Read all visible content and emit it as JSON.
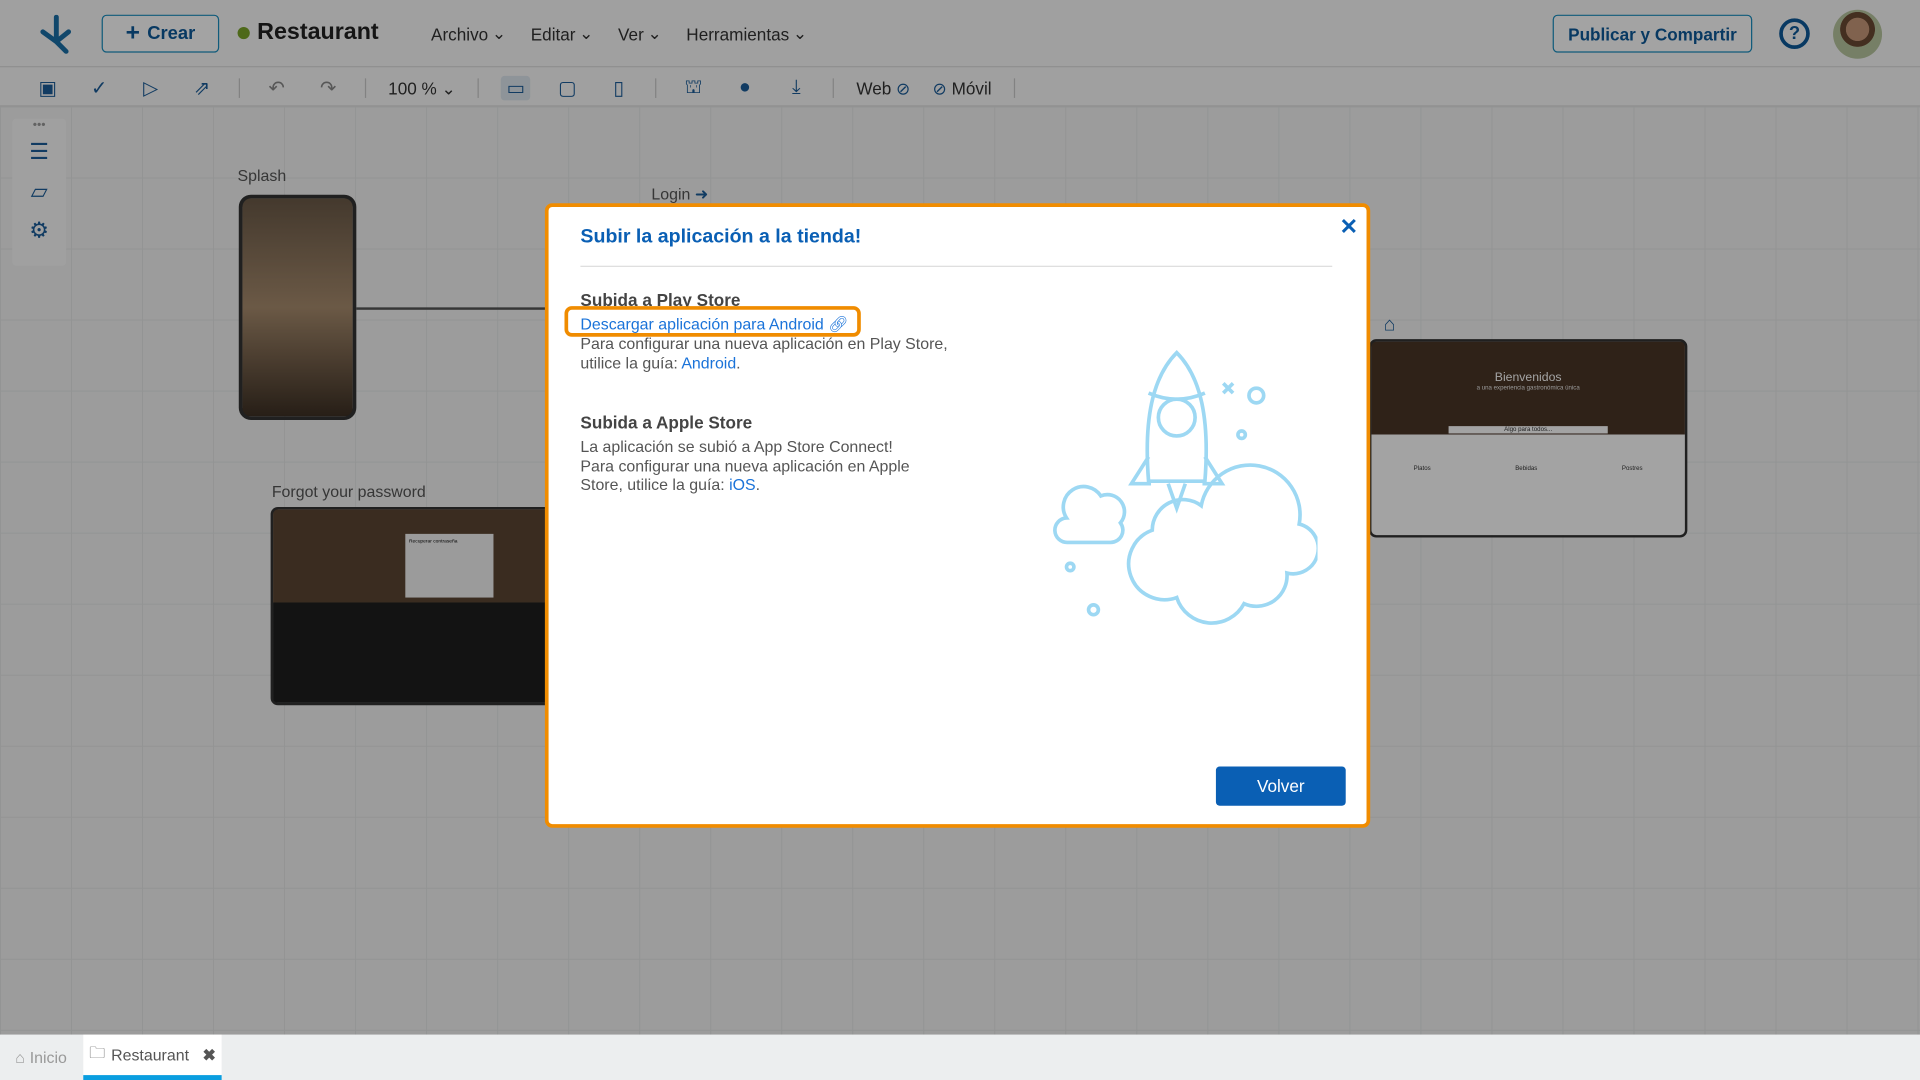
{
  "header": {
    "create_label": "Crear",
    "project_name": "Restaurant",
    "project_status_color": "#7aa52a",
    "menus": [
      "Archivo",
      "Editar",
      "Ver",
      "Herramientas"
    ],
    "publish_label": "Publicar y Compartir"
  },
  "toolbar": {
    "zoom": "100 %",
    "web_label": "Web",
    "mobile_label": "Móvil"
  },
  "canvas": {
    "nodes": {
      "splash": "Splash",
      "login": "Login",
      "forgot": "Forgot your password"
    },
    "web_preview": {
      "title": "Bienvenidos",
      "subtitle": "a una experiencia gastronómica única",
      "section": "Algo para todos...",
      "items": [
        "Platos",
        "Bebidas",
        "Postres"
      ]
    },
    "forgot_preview": {
      "dialog_title": "Recuperar contraseña"
    }
  },
  "modal": {
    "title": "Subir la aplicación a la tienda!",
    "play": {
      "heading": "Subida a Play Store",
      "download_link": "Descargar aplicación para Android",
      "text": "Para configurar una nueva aplicación en Play Store, utilice la guía:",
      "guide_link": "Android"
    },
    "apple": {
      "heading": "Subida a Apple Store",
      "line1": "La aplicación se subió a App Store Connect!",
      "text": "Para configurar una nueva aplicación en Apple Store, utilice la guía:",
      "guide_link": "iOS"
    },
    "back_label": "Volver",
    "accent": "#0a5fb4",
    "highlight": "#f08c00"
  },
  "bottom_tabs": [
    {
      "label": "Inicio",
      "icon": "home-icon"
    },
    {
      "label": "Restaurant",
      "icon": "folder-icon",
      "active": true
    }
  ]
}
